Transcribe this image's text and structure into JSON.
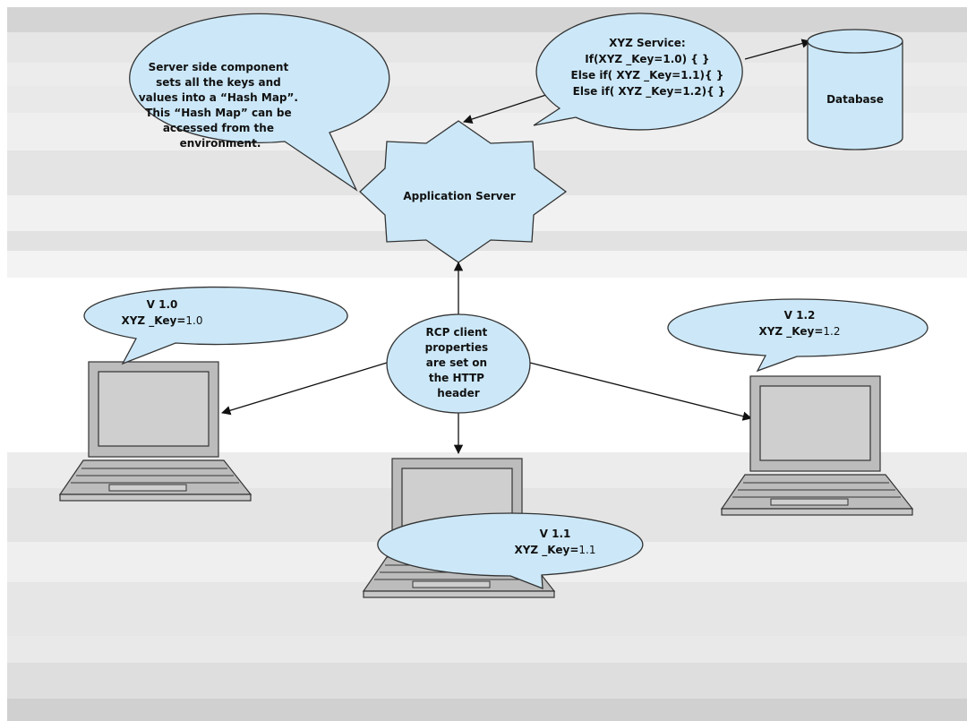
{
  "diagram": {
    "colors": {
      "fill_light_blue": "#cce8f8",
      "stroke": "#333333",
      "laptop_body": "#bcbcbc",
      "laptop_screen": "#cfcfcf",
      "band_dark": "#d6d6d6",
      "band_light": "#e8e8e8"
    },
    "server_callout": {
      "lines": [
        "Server side component",
        "sets all the keys and",
        "values into a “Hash Map”.",
        "This “Hash Map” can be",
        "accessed from the",
        "environment."
      ]
    },
    "service_callout": {
      "lines": [
        "XYZ Service:",
        "If(XYZ _Key=1.0) { }",
        "Else if( XYZ _Key=1.1){ }",
        "Else if( XYZ _Key=1.2){ }"
      ]
    },
    "database": {
      "label": "Database",
      "icon": "database-cylinder-icon"
    },
    "app_server": {
      "label": "Application Server",
      "icon": "star-burst-shape"
    },
    "rcp": {
      "lines": [
        "RCP client",
        "properties",
        "are set on",
        "the HTTP",
        "header"
      ]
    },
    "clients": [
      {
        "version": "V 1.0",
        "key_label": "XYZ _Key=",
        "key_value": "1.0",
        "icon": "laptop-icon"
      },
      {
        "version": "V 1.1",
        "key_label": "XYZ _Key=",
        "key_value": "1.1",
        "icon": "laptop-icon"
      },
      {
        "version": "V 1.2",
        "key_label": "XYZ _Key=",
        "key_value": "1.2",
        "icon": "laptop-icon"
      }
    ]
  }
}
